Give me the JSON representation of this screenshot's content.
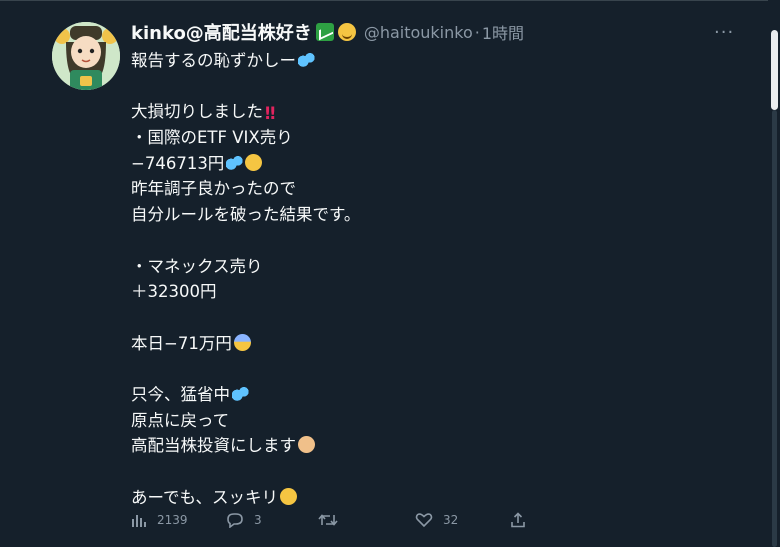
{
  "tweet": {
    "display_name": "kinko@高配当株好き",
    "handle": "@haitoukinko",
    "separator": "·",
    "time": "1時間",
    "more_label": "···",
    "lines": [
      {
        "text": "報告するの恥ずかしー",
        "emoji": [
          "sweat-drops"
        ]
      },
      {
        "text": "",
        "emoji": []
      },
      {
        "text": "大損切りしました",
        "emoji": [
          "double-exclamation"
        ]
      },
      {
        "text": "・国際のETF VIX売り",
        "emoji": []
      },
      {
        "text": "−746713円",
        "emoji": [
          "sweat-drops",
          "tired-face"
        ]
      },
      {
        "text": "昨年調子良かったので",
        "emoji": []
      },
      {
        "text": "自分ルールを破った結果です。",
        "emoji": []
      },
      {
        "text": "",
        "emoji": []
      },
      {
        "text": "・マネックス売り",
        "emoji": []
      },
      {
        "text": "＋32300円",
        "emoji": []
      },
      {
        "text": "",
        "emoji": []
      },
      {
        "text": "本日−71万円",
        "emoji": [
          "screaming-face"
        ]
      },
      {
        "text": "",
        "emoji": []
      },
      {
        "text": "只今、猛省中",
        "emoji": [
          "sweat-drops"
        ]
      },
      {
        "text": "原点に戻って",
        "emoji": []
      },
      {
        "text": "高配当株投資にします",
        "emoji": [
          "bowing-person"
        ]
      },
      {
        "text": "",
        "emoji": []
      },
      {
        "text": "あーでも、スッキリ",
        "emoji": [
          "grinning-sweat-face"
        ]
      }
    ]
  },
  "actions": {
    "views": "2139",
    "replies": "3",
    "retweets": "",
    "likes": "32"
  },
  "colors": {
    "background": "#15202b",
    "text": "#f7f9f9",
    "muted": "#8b98a5"
  }
}
